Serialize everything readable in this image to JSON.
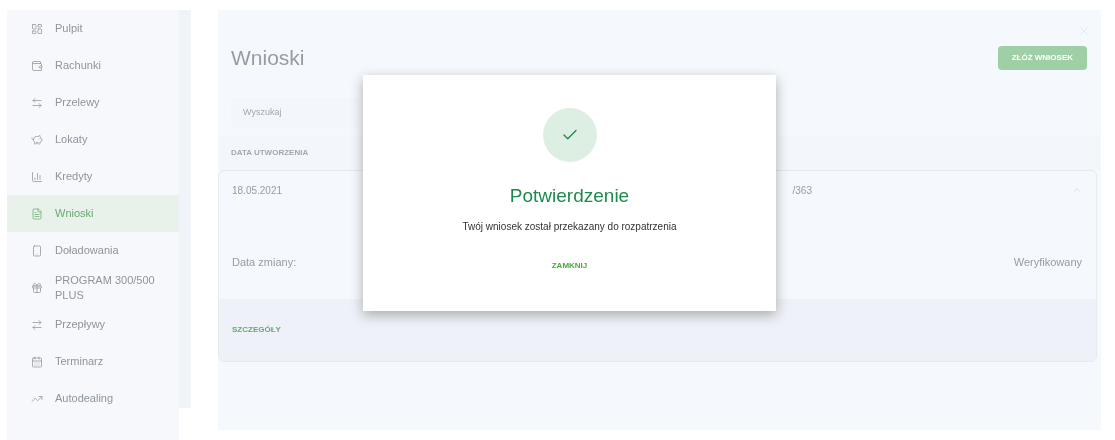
{
  "sidebar": {
    "items": [
      {
        "label": "Pulpit",
        "selected": false
      },
      {
        "label": "Rachunki",
        "selected": false
      },
      {
        "label": "Przelewy",
        "selected": false
      },
      {
        "label": "Lokaty",
        "selected": false
      },
      {
        "label": "Kredyty",
        "selected": false
      },
      {
        "label": "Wnioski",
        "selected": true
      },
      {
        "label": "Doładowania",
        "selected": false
      },
      {
        "label": "PROGRAM 300/500 PLUS",
        "selected": false
      },
      {
        "label": "Przepływy",
        "selected": false
      },
      {
        "label": "Terminarz",
        "selected": false
      },
      {
        "label": "Autodealing",
        "selected": false
      }
    ]
  },
  "page": {
    "title": "Wnioski",
    "submit_button": "ZŁÓŻ WNIOSEK",
    "search": {
      "placeholder": "Wyszukaj"
    },
    "table": {
      "columns": [
        "DATA UTWORZENIA"
      ],
      "rows": [
        {
          "date": "18.05.2021",
          "column_2": "/363",
          "expanded": true,
          "change_label": "Data zmiany:",
          "status": "Weryfikowany",
          "details_link": "SZCZEGÓŁY"
        }
      ]
    }
  },
  "dialog": {
    "title": "Potwierdzenie",
    "message": "Twój wniosek został przekazany do rozpatrzenia",
    "button": "ZAMKNIJ"
  }
}
